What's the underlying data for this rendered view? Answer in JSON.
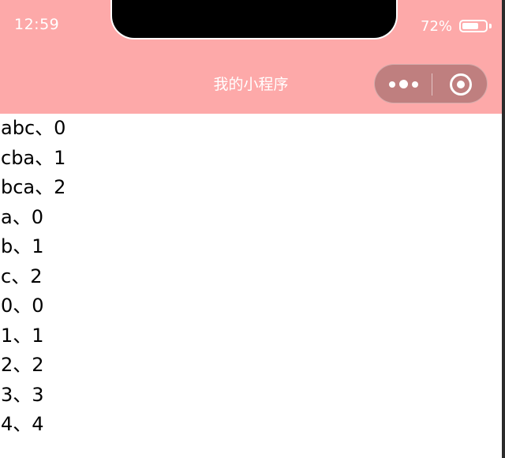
{
  "status_bar": {
    "time": "12:59",
    "battery_percent": "72%",
    "battery_level": 0.72
  },
  "nav": {
    "title": "我的小程序"
  },
  "list": {
    "items": [
      "abc、0",
      "cba、1",
      "bca、2",
      "a、0",
      "b、1",
      "c、2",
      "0、0",
      "1、1",
      "2、2",
      "3、3",
      "4、4"
    ]
  },
  "colors": {
    "header_bg": "#fda9a9",
    "text": "#000000",
    "header_text": "#ffffff"
  },
  "icons": {
    "menu": "more-dots-icon",
    "close": "close-target-icon",
    "battery": "battery-icon"
  }
}
